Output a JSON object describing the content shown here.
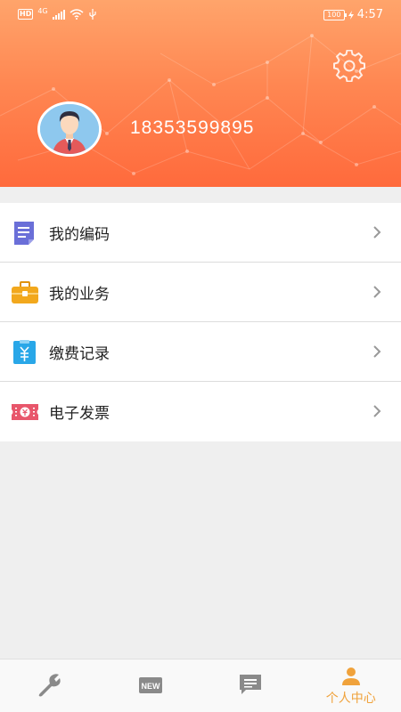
{
  "status_bar": {
    "hd": "HD",
    "network": "4G",
    "battery": "100",
    "time": "4:57"
  },
  "profile": {
    "phone": "18353599895"
  },
  "menu": {
    "items": [
      {
        "label": "我的编码",
        "icon": "document-icon"
      },
      {
        "label": "我的业务",
        "icon": "briefcase-icon"
      },
      {
        "label": "缴费记录",
        "icon": "payment-record-icon"
      },
      {
        "label": "电子发票",
        "icon": "ticket-icon"
      }
    ]
  },
  "bottom_nav": {
    "items": [
      {
        "icon": "wrench-icon",
        "label": ""
      },
      {
        "icon": "new-icon",
        "label": "",
        "badge": "NEW"
      },
      {
        "icon": "message-icon",
        "label": ""
      },
      {
        "icon": "person-icon",
        "label": "个人中心",
        "active": true
      }
    ]
  },
  "colors": {
    "accent": "#f0a23b",
    "header_top": "#ffa46b",
    "header_bottom": "#ff6a3c",
    "doc_icon": "#6a6fd8",
    "briefcase_icon": "#f2a81d",
    "payment_icon": "#29a7e8",
    "ticket_icon": "#e8566b"
  }
}
